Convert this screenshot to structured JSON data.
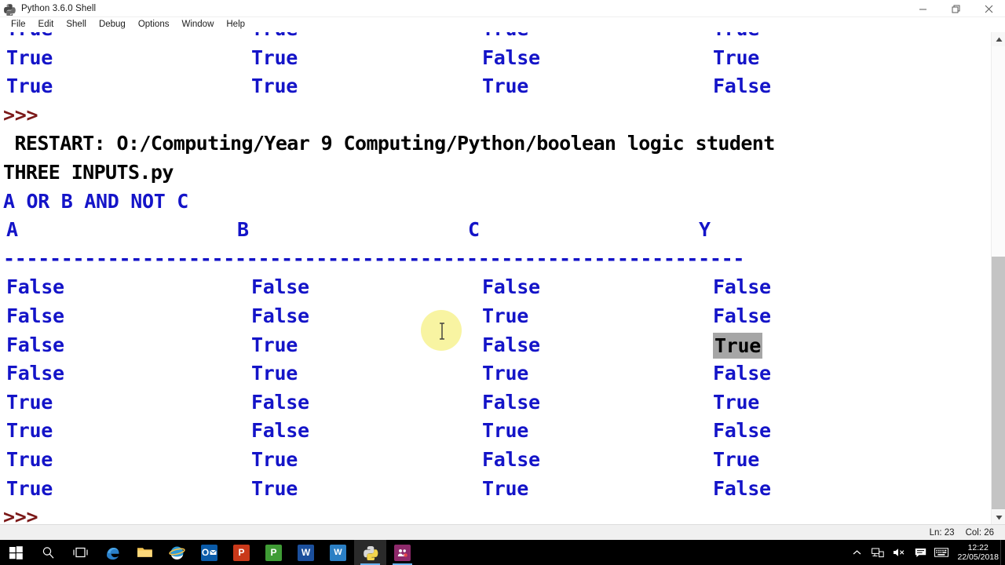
{
  "window": {
    "title": "Python 3.6.0 Shell",
    "icon": "python-logo-icon",
    "minimize_label": "–",
    "maximize_label": "❐",
    "close_label": "✕"
  },
  "menubar": {
    "items": [
      {
        "label": "File"
      },
      {
        "label": "Edit"
      },
      {
        "label": "Shell"
      },
      {
        "label": "Debug"
      },
      {
        "label": "Options"
      },
      {
        "label": "Window"
      },
      {
        "label": "Help"
      }
    ]
  },
  "shell": {
    "clipped_top_row": {
      "a": "True",
      "b": "True",
      "c": "True",
      "y": "True"
    },
    "previous_rows": [
      {
        "a": "True",
        "b": "True",
        "c": "False",
        "y": "True"
      },
      {
        "a": "True",
        "b": "True",
        "c": "True",
        "y": "False"
      }
    ],
    "prompt_1": ">>>",
    "restart_line_1": " RESTART: O:/Computing/Year 9 Computing/Python/boolean logic student",
    "restart_line_2": "THREE INPUTS.py",
    "expression": "A OR B AND NOT C",
    "headers": {
      "a": "A",
      "b": "B",
      "c": "C",
      "y": "Y"
    },
    "separator": "----------------------------------------------------------------",
    "table_rows": [
      {
        "a": "False",
        "b": "False",
        "c": "False",
        "y": "False",
        "y_selected": false
      },
      {
        "a": "False",
        "b": "False",
        "c": "True",
        "y": "False",
        "y_selected": false
      },
      {
        "a": "False",
        "b": "True",
        "c": "False",
        "y": "True",
        "y_selected": true
      },
      {
        "a": "False",
        "b": "True",
        "c": "True",
        "y": "False",
        "y_selected": false
      },
      {
        "a": "True",
        "b": "False",
        "c": "False",
        "y": "True",
        "y_selected": false
      },
      {
        "a": "True",
        "b": "False",
        "c": "True",
        "y": "False",
        "y_selected": false
      },
      {
        "a": "True",
        "b": "True",
        "c": "False",
        "y": "True",
        "y_selected": false
      },
      {
        "a": "True",
        "b": "True",
        "c": "True",
        "y": "False",
        "y_selected": false
      }
    ],
    "prompt_2": ">>>",
    "colors": {
      "output_blue": "#1414c8",
      "prompt_maroon": "#7b1818",
      "restart_black": "#000000",
      "selection_grey": "#a6a6a6",
      "cursor_highlight_yellow": "#f7f39a"
    }
  },
  "scrollbar": {
    "up_arrow": "▲",
    "down_arrow": "▼"
  },
  "statusbar": {
    "line": "Ln: 23",
    "col": "Col: 26"
  },
  "taskbar": {
    "items": [
      {
        "name": "start-button",
        "label": "Start"
      },
      {
        "name": "search-icon",
        "label": "Search"
      },
      {
        "name": "task-view-icon",
        "label": "Task View"
      },
      {
        "name": "edge-icon",
        "label": "Microsoft Edge"
      },
      {
        "name": "file-explorer-icon",
        "label": "File Explorer"
      },
      {
        "name": "internet-explorer-icon",
        "label": "Internet Explorer"
      },
      {
        "name": "outlook-icon",
        "label": "Outlook",
        "tile": "O"
      },
      {
        "name": "powerpoint-icon",
        "label": "PowerPoint",
        "tile": "P"
      },
      {
        "name": "publisher-icon",
        "label": "Publisher",
        "tile": "P"
      },
      {
        "name": "word-icon",
        "label": "Word",
        "tile": "W"
      },
      {
        "name": "wordpad-icon",
        "label": "WordPad",
        "tile": "W"
      },
      {
        "name": "python-idle-icon",
        "label": "Python 3.6.0 Shell"
      },
      {
        "name": "remote-app-icon",
        "label": "Classroom Management"
      }
    ],
    "tray": {
      "chevron": "⌃",
      "network_icon": "network-icon",
      "volume_icon": "volume-muted-icon",
      "action_center_icon": "action-center-icon",
      "keyboard_icon": "touch-keyboard-icon",
      "time": "12:22",
      "date": "22/05/2018"
    }
  }
}
